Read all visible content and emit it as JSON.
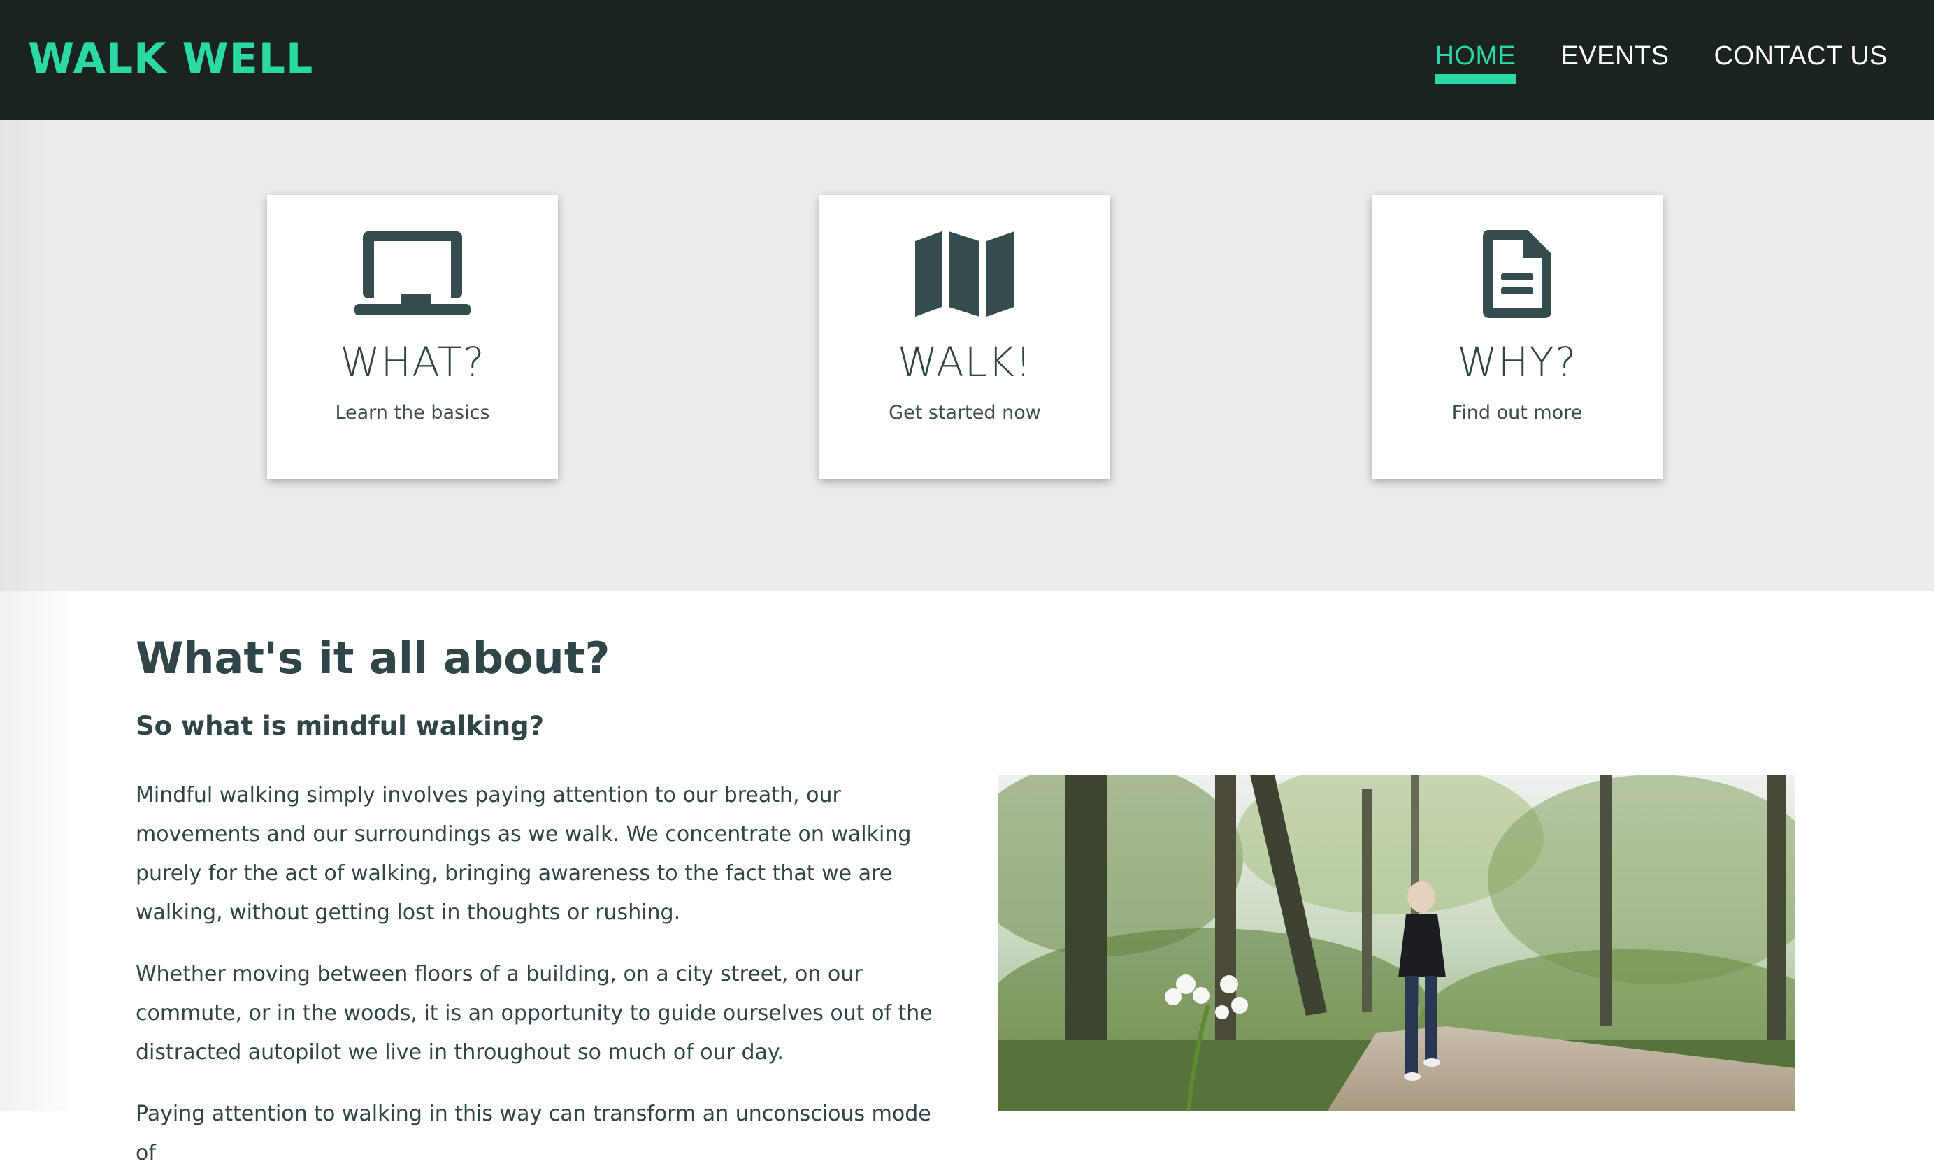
{
  "header": {
    "logo": "WALK WELL",
    "nav": [
      {
        "label": "HOME",
        "active": true
      },
      {
        "label": "EVENTS",
        "active": false
      },
      {
        "label": "CONTACT US",
        "active": false
      }
    ]
  },
  "cards": [
    {
      "icon": "laptop-icon",
      "title": "WHAT?",
      "subtitle": "Learn the basics"
    },
    {
      "icon": "map-icon",
      "title": "WALK!",
      "subtitle": "Get started now"
    },
    {
      "icon": "document-icon",
      "title": "WHY?",
      "subtitle": "Find out more"
    }
  ],
  "about": {
    "heading": "What's it all about?",
    "subheading": "So what is mindful walking?",
    "paragraphs": [
      "Mindful walking simply involves paying attention to our breath, our movements and our surroundings as we walk. We concentrate on walking purely for the act of walking, bringing awareness to the fact that we are walking, without getting lost in thoughts or rushing.",
      "Whether moving between floors of a building, on a city street, on our commute, or in the woods, it is an opportunity to guide ourselves out of the distracted autopilot we live in throughout so much of our day.",
      "Paying attention to walking in this way can transform an unconscious mode of"
    ]
  },
  "colors": {
    "accent": "#2bd9a4",
    "header_bg": "#1b2322",
    "band_bg": "#ececec",
    "text": "#2f4548",
    "icon": "#344c4c"
  }
}
